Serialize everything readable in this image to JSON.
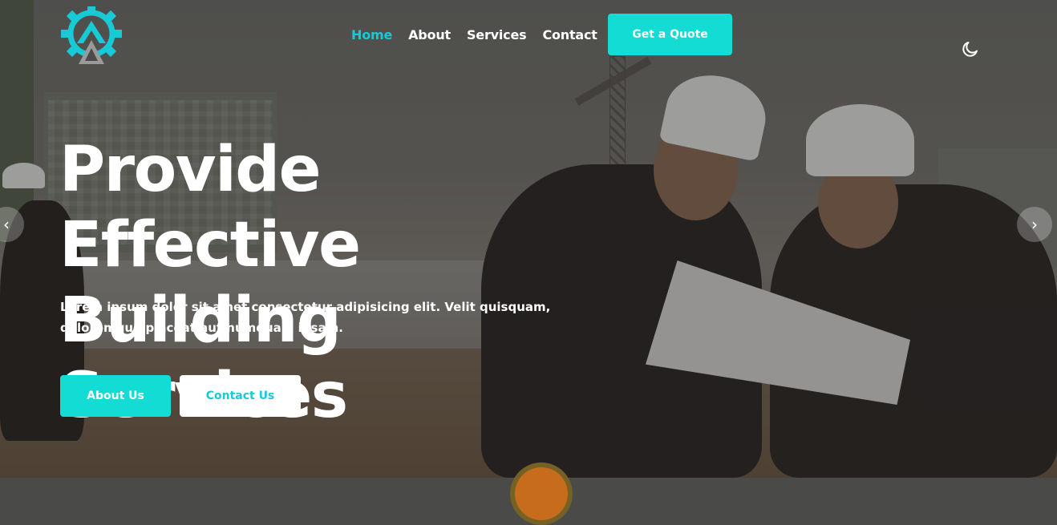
{
  "colors": {
    "accent": "#12dcd4",
    "nav_active": "#18c9d6",
    "text": "#ffffff"
  },
  "header": {
    "logo_icon": "gear-a-logo-icon",
    "nav": [
      {
        "label": "Home",
        "active": true
      },
      {
        "label": "About",
        "active": false
      },
      {
        "label": "Services",
        "active": false
      },
      {
        "label": "Contact",
        "active": false
      }
    ],
    "quote_button": "Get a Quote",
    "theme_toggle_icon": "moon-icon"
  },
  "hero": {
    "title_line1": "Provide Effective",
    "title_line2": "Building Services",
    "subtitle": "Lorem ipsum dolor sit amet consectetur adipisicing elit. Velit quisquam, doloremque placeat aut numquam ipsam.",
    "about_button": "About Us",
    "contact_button": "Contact Us",
    "prev_icon": "chevron-left-icon",
    "next_icon": "chevron-right-icon",
    "prev_glyph": "‹",
    "next_glyph": "›"
  }
}
